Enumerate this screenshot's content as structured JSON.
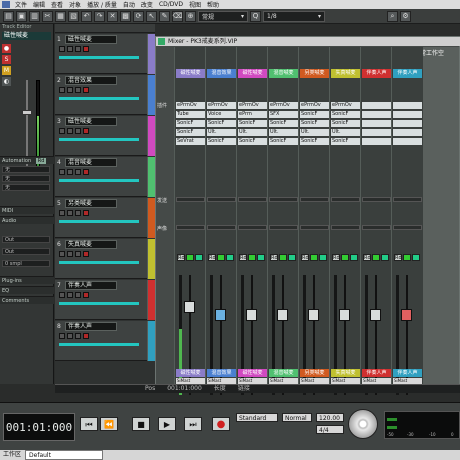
{
  "menubar": {
    "items": [
      "文件",
      "编辑",
      "查看",
      "对象",
      "播放 / 质量",
      "自动",
      "改变",
      "CD/DVD",
      "视图",
      "帮助"
    ]
  },
  "toolbar": {
    "preset_select": "常规",
    "counter": "1/8"
  },
  "inspector": {
    "title": "Track Editor",
    "track_name": "磁性喊麦",
    "sections": [
      "Automation",
      "MIDI",
      "Audio",
      "Plug-ins",
      "EQ",
      "Comments"
    ],
    "automation_badge": "Rd",
    "field_values": [
      "无",
      "无",
      "无",
      "Out",
      "Out",
      "0 smpl"
    ]
  },
  "tracks": [
    {
      "num": "1",
      "name": "磁性喊麦",
      "color": "#8a7cc8"
    },
    {
      "num": "2",
      "name": "混音效果",
      "color": "#4a7fd0"
    },
    {
      "num": "3",
      "name": "磁性喊麦",
      "color": "#d04ac0"
    },
    {
      "num": "4",
      "name": "混音喊麦",
      "color": "#50c070"
    },
    {
      "num": "5",
      "name": "另类喊麦",
      "color": "#d05a20"
    },
    {
      "num": "6",
      "name": "失真喊麦",
      "color": "#c0c030"
    },
    {
      "num": "7",
      "name": "伴奏人声",
      "color": "#d03030"
    },
    {
      "num": "8",
      "name": "伴奏人声",
      "color": "#30a0c0"
    }
  ],
  "mixer": {
    "title": "Mixer - PK3戒麦系列.VIP",
    "right_header": "常工作空",
    "row_labels": [
      "插件",
      "发送",
      "声像"
    ],
    "strips": [
      {
        "name": "磁性喊麦",
        "color": "#8a7cc8",
        "inserts": [
          "ePrmOv",
          "Tube",
          "SonicF",
          "SonicF",
          "SeVrat"
        ],
        "fader": 0.28,
        "meter": 0.55
      },
      {
        "name": "混音效果",
        "color": "#4a7fd0",
        "inserts": [
          "ePrmOv",
          "Voice",
          "SonicF",
          "Ult.",
          "SonicF"
        ],
        "fader": 0.22,
        "meter": 0
      },
      {
        "name": "磁性喊麦",
        "color": "#d04ac0",
        "inserts": [
          "ePrmOv",
          "ePrm",
          "SonicF",
          "Ult.",
          "SonicF"
        ],
        "fader": 0.22,
        "meter": 0
      },
      {
        "name": "混音喊麦",
        "color": "#50c070",
        "inserts": [
          "ePrmOv",
          "SFX",
          "SonicF",
          "Ult.",
          "SonicF"
        ],
        "fader": 0.22,
        "meter": 0
      },
      {
        "name": "另类喊麦",
        "color": "#d05a20",
        "inserts": [
          "ePrmOv",
          "SonicF",
          "SonicF",
          "Ult.",
          "SonicF"
        ],
        "fader": 0.22,
        "meter": 0
      },
      {
        "name": "失真喊麦",
        "color": "#c0c030",
        "inserts": [
          "ePrmOv",
          "SonicF",
          "SonicF",
          "Ult.",
          "SonicF"
        ],
        "fader": 0.22,
        "meter": 0
      },
      {
        "name": "伴奏人声",
        "color": "#d03030",
        "inserts": [
          "",
          "",
          "",
          "",
          ""
        ],
        "fader": 0.22,
        "meter": 0
      },
      {
        "name": "伴奏人声",
        "color": "#30a0c0",
        "inserts": [
          "",
          "",
          "",
          "",
          ""
        ],
        "fader": 0.22,
        "meter": 0
      }
    ],
    "io_label": "SiMast"
  },
  "status": {
    "pos_label": "Pos",
    "pos_value": "001:01:000",
    "field": "长度",
    "mode": "链接"
  },
  "transport": {
    "time": "001:01:000",
    "mode_select": "Standard",
    "normal_select": "Normal",
    "tempo": "120.00",
    "signature": "4/4",
    "buttons": [
      "⏮",
      "⏪",
      "■",
      "▶",
      "⏭",
      "●"
    ],
    "meter_labels": [
      "-50",
      "-30",
      "-10",
      "0"
    ]
  },
  "bottombar": {
    "label": "工作区",
    "select": "Default"
  }
}
